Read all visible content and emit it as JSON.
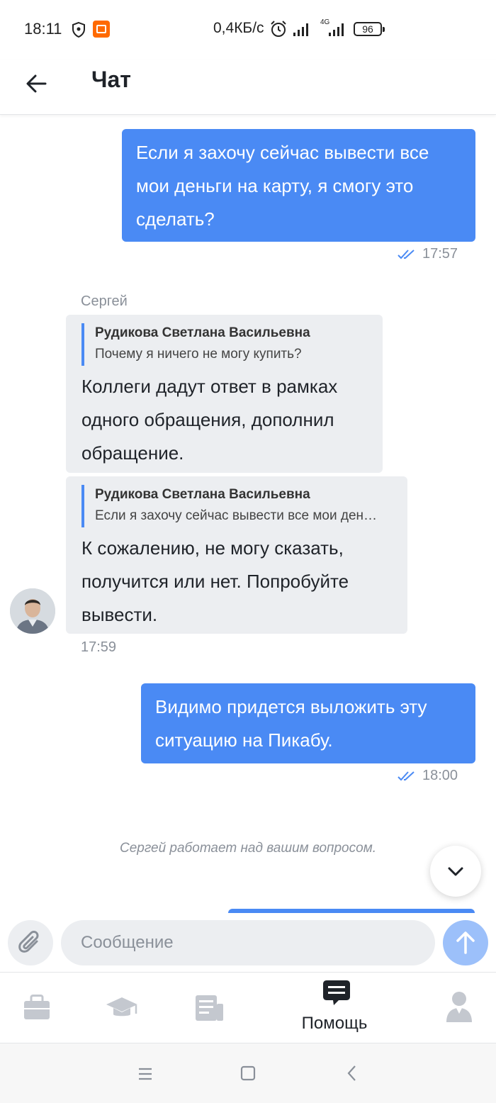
{
  "status_bar": {
    "time": "18:11",
    "speed": "0,4КБ/с",
    "network": "4G",
    "battery": "96"
  },
  "header": {
    "title": "Чат"
  },
  "messages": {
    "out_1": {
      "lines": [
        "Если я захочу сейчас вывести все",
        "мои деньги на карту, я смогу это",
        "сделать?"
      ],
      "time": "17:57"
    },
    "sender_name": "Сергей",
    "in_1": {
      "quote_author": "Рудикова Светлана Васильевна",
      "quote_text": "Почему я ничего не могу купить?",
      "lines": [
        "Коллеги дадут ответ в рамках",
        "одного обращения, дополнил",
        "обращение."
      ]
    },
    "in_2": {
      "quote_author": "Рудикова Светлана Васильевна",
      "quote_text": "Если я захочу сейчас вывести все мои деньги на карту, я смогу это сделать?",
      "lines": [
        "К сожалению, не могу сказать,",
        "получится или нет. Попробуйте",
        "вывести."
      ]
    },
    "in_time": "17:59",
    "out_2": {
      "lines": [
        "Видимо придется выложить эту",
        "ситуацию на Пикабу."
      ],
      "time": "18:00"
    }
  },
  "typing_status": "Сергей работает над вашим вопросом.",
  "input": {
    "placeholder": "Сообщение",
    "value": ""
  },
  "tabs": [
    {
      "icon": "briefcase-icon",
      "label": ""
    },
    {
      "icon": "graduation-cap-icon",
      "label": ""
    },
    {
      "icon": "news-icon",
      "label": ""
    },
    {
      "icon": "chat-icon",
      "label": "Помощь",
      "active": true
    },
    {
      "icon": "profile-icon",
      "label": ""
    }
  ],
  "colors": {
    "accent": "#4a8af4",
    "incoming_bubble": "#eceef1",
    "send_disabled": "#9cc0fa",
    "muted_text": "#8a9099",
    "inactive_icon": "#c4c8cf"
  }
}
